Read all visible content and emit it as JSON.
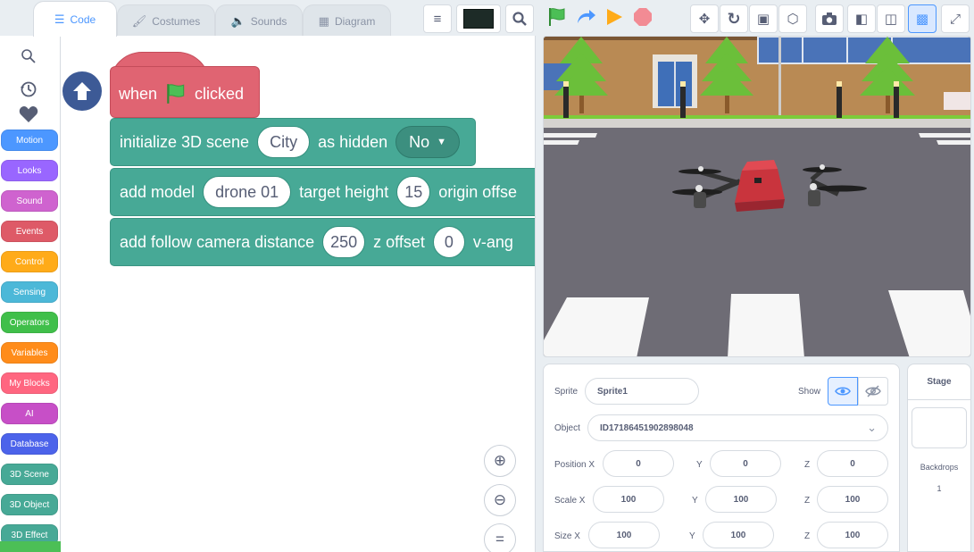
{
  "tabs": [
    {
      "label": "Code",
      "icon": "code-icon"
    },
    {
      "label": "Costumes",
      "icon": "brush-icon"
    },
    {
      "label": "Sounds",
      "icon": "speaker-icon"
    },
    {
      "label": "Diagram",
      "icon": "diagram-icon"
    }
  ],
  "toolbar": {
    "color_value": "#1d2b27"
  },
  "palette": {
    "categories": [
      {
        "label": "Motion",
        "color": "#4c97ff"
      },
      {
        "label": "Looks",
        "color": "#9966ff"
      },
      {
        "label": "Sound",
        "color": "#cf63cf"
      },
      {
        "label": "Events",
        "color": "#de5a67"
      },
      {
        "label": "Control",
        "color": "#ffab19"
      },
      {
        "label": "Sensing",
        "color": "#4cb8d8"
      },
      {
        "label": "Operators",
        "color": "#40bf4a"
      },
      {
        "label": "Variables",
        "color": "#ff8c1a"
      },
      {
        "label": "My Blocks",
        "color": "#ff6680"
      },
      {
        "label": "AI",
        "color": "#c74fc7"
      },
      {
        "label": "Database",
        "color": "#4c63ea"
      },
      {
        "label": "3D Scene",
        "color": "#47a996"
      },
      {
        "label": "3D Object",
        "color": "#47a996"
      },
      {
        "label": "3D Effect",
        "color": "#47a996"
      }
    ]
  },
  "script": {
    "hat": {
      "text_before": "when",
      "text_after": "clicked"
    },
    "block1": {
      "text1": "initialize 3D scene",
      "value1": "City",
      "text2": "as hidden",
      "dropdown": "No"
    },
    "block2": {
      "text1": "add model",
      "value1": "drone 01",
      "text2": "target height",
      "value2": "15",
      "text3": "origin offse"
    },
    "block3": {
      "text1": "add follow camera distance",
      "value1": "250",
      "text2": "z offset",
      "value2": "0",
      "text3": "v-ang"
    }
  },
  "sprite": {
    "sprite_label": "Sprite",
    "sprite_name": "Sprite1",
    "show_label": "Show",
    "object_label": "Object",
    "object_id": "ID17186451902898048",
    "position": {
      "label": "Position X",
      "x": "0",
      "y_label": "Y",
      "y": "0",
      "z_label": "Z",
      "z": "0"
    },
    "scale": {
      "label": "Scale X",
      "x": "100",
      "y_label": "Y",
      "y": "100",
      "z_label": "Z",
      "z": "100"
    },
    "size": {
      "label": "Size X",
      "x": "100",
      "y_label": "Y",
      "y": "100",
      "z_label": "Z",
      "z": "100"
    }
  },
  "stage_panel": {
    "title": "Stage",
    "backdrops_label": "Backdrops",
    "backdrops_count": "1"
  }
}
